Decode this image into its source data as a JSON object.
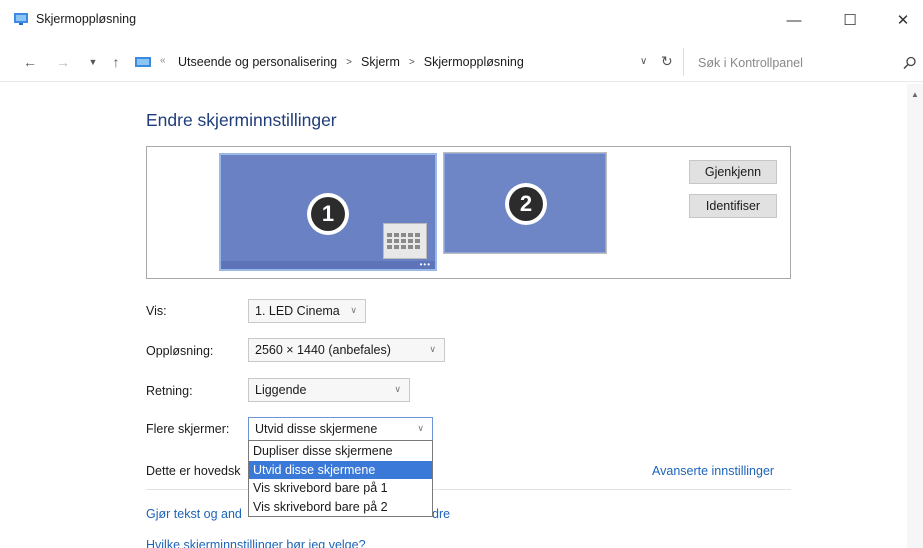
{
  "window": {
    "title": "Skjermoppløsning",
    "controls": {
      "minimize": "—",
      "maximize": "☐",
      "close": "✕"
    }
  },
  "addressbar": {
    "breadcrumbs": [
      "Utseende og personalisering",
      "Skjerm",
      "Skjermoppløsning"
    ],
    "search_placeholder": "Søk i Kontrollpanel"
  },
  "main": {
    "heading": "Endre skjerminnstillinger",
    "monitors": [
      {
        "number": "1"
      },
      {
        "number": "2"
      }
    ],
    "buttons": {
      "detect": "Gjenkjenn",
      "identify": "Identifiser"
    },
    "fields": {
      "display": {
        "label": "Vis:",
        "value": "1. LED Cinema"
      },
      "resolution": {
        "label": "Oppløsning:",
        "value": "2560 × 1440 (anbefales)"
      },
      "orientation": {
        "label": "Retning:",
        "value": "Liggende"
      },
      "multiple": {
        "label": "Flere skjermer:",
        "value": "Utvid disse skjermene"
      }
    },
    "dropdown_options": [
      "Dupliser disse skjermene",
      "Utvid disse skjermene",
      "Vis skrivebord bare på 1",
      "Vis skrivebord bare på 2"
    ],
    "selected_option_index": 1,
    "main_display_text": "Dette er hovedsk",
    "advanced_link": "Avanserte innstillinger",
    "link_text_size_start": "Gjør tekst og and",
    "link_text_size_end": "dre",
    "link_which_settings": "Hvilke skjerminnstillinger bør jeg velge?"
  },
  "colors": {
    "heading": "#1f3d7a",
    "link": "#1d64b8",
    "monitor": "#6a81c4",
    "selection": "#3b79d9"
  }
}
